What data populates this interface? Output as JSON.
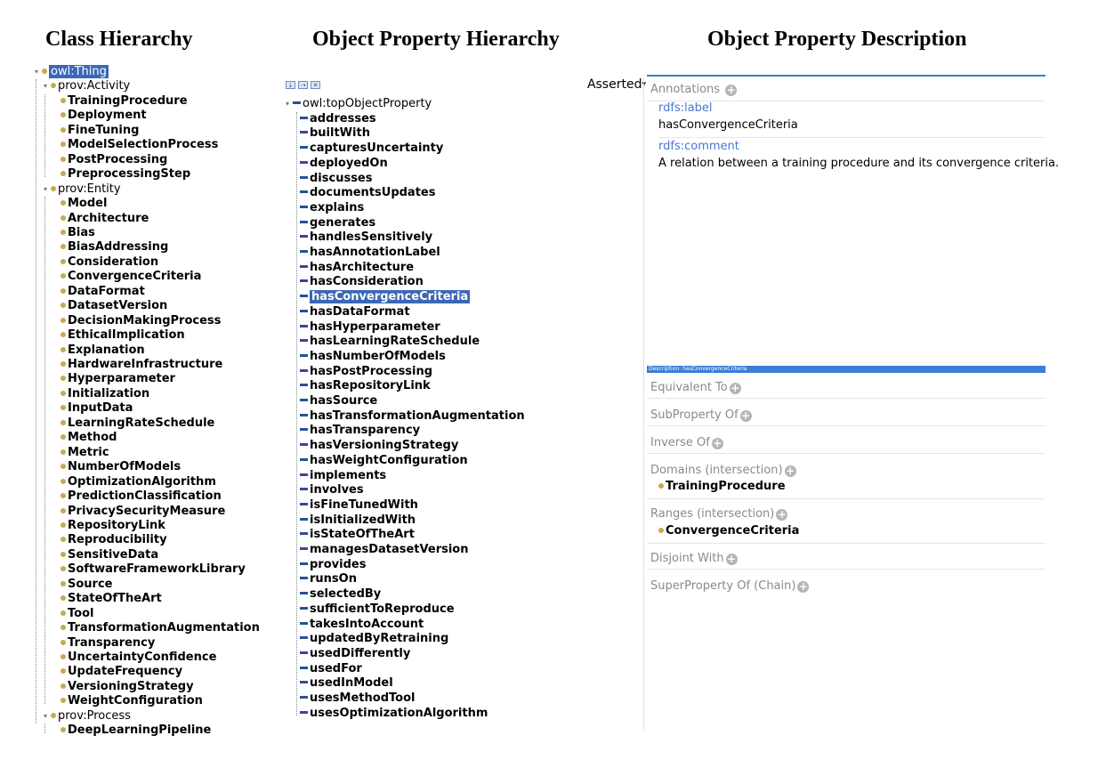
{
  "headings": {
    "class_hierarchy": "Class Hierarchy",
    "object_property_hierarchy": "Object Property Hierarchy",
    "object_property_description": "Object Property Description"
  },
  "class_tree": {
    "root": "owl:Thing",
    "groups": [
      {
        "label": "prov:Activity",
        "children": [
          "TrainingProcedure",
          "Deployment",
          "FineTuning",
          "ModelSelectionProcess",
          "PostProcessing",
          "PreprocessingStep"
        ]
      },
      {
        "label": "prov:Entity",
        "children": [
          "Model",
          "Architecture",
          "Bias",
          "BiasAddressing",
          "Consideration",
          "ConvergenceCriteria",
          "DataFormat",
          "DatasetVersion",
          "DecisionMakingProcess",
          "EthicalImplication",
          "Explanation",
          "HardwareInfrastructure",
          "Hyperparameter",
          "Initialization",
          "InputData",
          "LearningRateSchedule",
          "Method",
          "Metric",
          "NumberOfModels",
          "OptimizationAlgorithm",
          "PredictionClassification",
          "PrivacySecurityMeasure",
          "RepositoryLink",
          "Reproducibility",
          "SensitiveData",
          "SoftwareFrameworkLibrary",
          "Source",
          "StateOfTheArt",
          "Tool",
          "TransformationAugmentation",
          "Transparency",
          "UncertaintyConfidence",
          "UpdateFrequency",
          "VersioningStrategy",
          "WeightConfiguration"
        ]
      },
      {
        "label": "prov:Process",
        "children": [
          "DeepLearningPipeline"
        ]
      }
    ]
  },
  "object_tree": {
    "toolbar_icons": [
      "add-sub-property-icon",
      "add-sibling-property-icon",
      "delete-property-icon"
    ],
    "view_mode": "Asserted",
    "root": "owl:topObjectProperty",
    "selected": "hasConvergenceCriteria",
    "properties": [
      "addresses",
      "builtWith",
      "capturesUncertainty",
      "deployedOn",
      "discusses",
      "documentsUpdates",
      "explains",
      "generates",
      "handlesSensitively",
      "hasAnnotationLabel",
      "hasArchitecture",
      "hasConsideration",
      "hasConvergenceCriteria",
      "hasDataFormat",
      "hasHyperparameter",
      "hasLearningRateSchedule",
      "hasNumberOfModels",
      "hasPostProcessing",
      "hasRepositoryLink",
      "hasSource",
      "hasTransformationAugmentation",
      "hasTransparency",
      "hasVersioningStrategy",
      "hasWeightConfiguration",
      "implements",
      "involves",
      "isFineTunedWith",
      "isInitializedWith",
      "isStateOfTheArt",
      "managesDatasetVersion",
      "provides",
      "runsOn",
      "selectedBy",
      "sufficientToReproduce",
      "takesIntoAccount",
      "updatedByRetraining",
      "usedDifferently",
      "usedFor",
      "usedInModel",
      "usesMethodTool",
      "usesOptimizationAlgorithm"
    ]
  },
  "annotations": {
    "title": "Annotations",
    "label_key": "rdfs:label",
    "label_value": "hasConvergenceCriteria",
    "comment_key": "rdfs:comment",
    "comment_value": "A relation between a training procedure and its convergence criteria."
  },
  "description": {
    "header": "Description: hasConvergenceCriteria",
    "equivalent_to": "Equivalent To",
    "subproperty_of": "SubProperty Of",
    "inverse_of": "Inverse Of",
    "domains_label": "Domains (intersection)",
    "domain_value": "TrainingProcedure",
    "ranges_label": "Ranges (intersection)",
    "range_value": "ConvergenceCriteria",
    "disjoint_with": "Disjoint With",
    "superproperty_of_chain": "SuperProperty Of (Chain)"
  },
  "colors": {
    "selection": "#3b68b5",
    "class_dot": "#c8a94f",
    "property_dash": "#2a4f9a",
    "accent": "#3b7dd8",
    "link": "#4a78d0"
  }
}
